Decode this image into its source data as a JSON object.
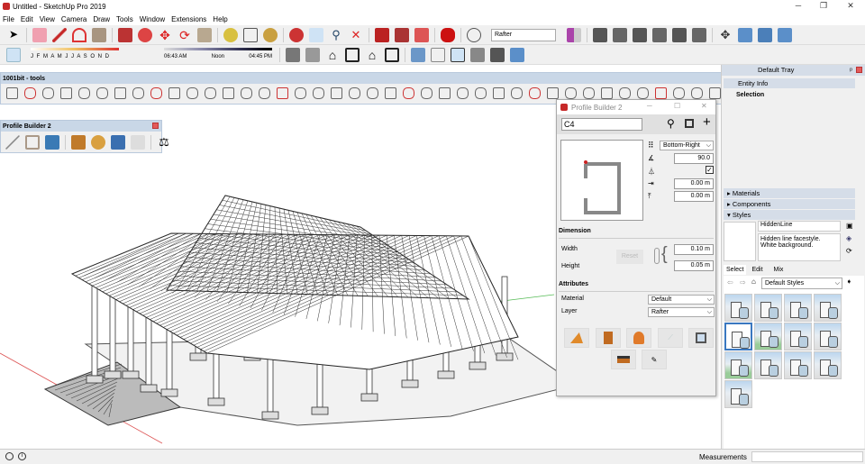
{
  "window": {
    "title": "Untitled - SketchUp Pro 2019"
  },
  "menu": [
    "File",
    "Edit",
    "View",
    "Camera",
    "Draw",
    "Tools",
    "Window",
    "Extensions",
    "Help"
  ],
  "toolbar": {
    "layer_value": "Rafter",
    "months": "J F M A M J J A S O N D",
    "time_start": "06:43 AM",
    "time_noon": "Noon",
    "time_end": "04:45 PM"
  },
  "toolbar_1001bit": {
    "title": "1001bit - tools"
  },
  "toolbar_pb": {
    "title": "Profile Builder 2"
  },
  "profile_builder": {
    "title": "Profile Builder 2",
    "profile_name": "C4",
    "alignment": "Bottom-Right",
    "rotation": "90.0",
    "mirror_checked": true,
    "offset_x": "0.00 m",
    "offset_y": "0.00 m",
    "dimension_header": "Dimension",
    "width_label": "Width",
    "width_value": "0.10 m",
    "height_label": "Height",
    "height_value": "0.05 m",
    "reset_label": "Reset",
    "attributes_header": "Attributes",
    "material_label": "Material",
    "material_value": "Default",
    "layer_label": "Layer",
    "layer_value": "Rafter"
  },
  "tray": {
    "title": "Default Tray",
    "entity_info": "Entity Info",
    "selection": "Selection",
    "materials": "Materials",
    "components": "Components",
    "styles": "Styles",
    "style_name": "HiddenLine",
    "style_desc": "Hidden line facestyle. White background.",
    "tabs": [
      "Select",
      "Edit",
      "Mix"
    ],
    "collection": "Default Styles"
  },
  "status": {
    "measurements_label": "Measurements",
    "measurements_value": ""
  }
}
